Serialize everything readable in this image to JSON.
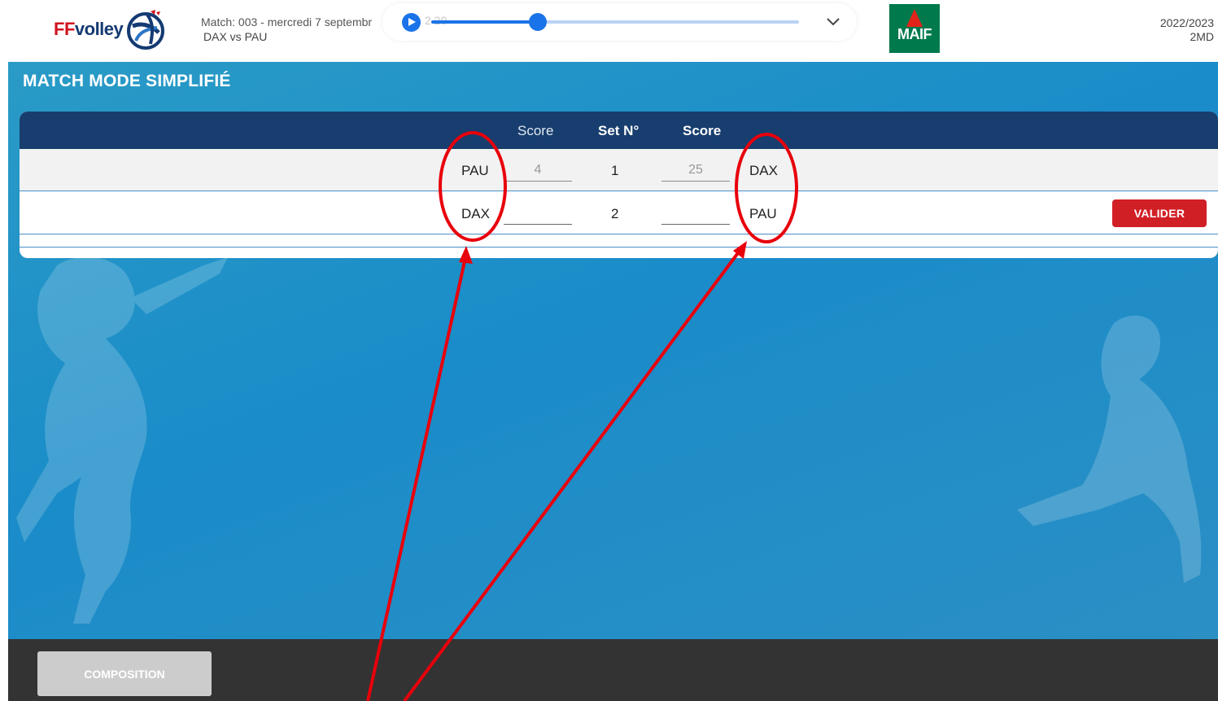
{
  "header": {
    "logo_ff": "FF",
    "logo_volley": "volley",
    "match_line1": "Match: 003 - mercredi 7 septembr",
    "match_line1_tail": "2 20",
    "match_line2": "DAX vs PAU",
    "player": {
      "progress_percent": 29
    },
    "sponsor": "MAIF",
    "season": "2022/2023",
    "division": "2MD"
  },
  "page": {
    "title": "MATCH MODE SIMPLIFIÉ"
  },
  "table": {
    "headers": {
      "score_left": "Score",
      "set": "Set N°",
      "score_right": "Score"
    },
    "rows": [
      {
        "team_left": "PAU",
        "score_left": "4",
        "set": "1",
        "score_right": "25",
        "team_right": "DAX"
      },
      {
        "team_left": "DAX",
        "score_left": "",
        "set": "2",
        "score_right": "",
        "team_right": "PAU"
      }
    ],
    "submit_label": "VALIDER"
  },
  "footer": {
    "composition_label": "COMPOSITION"
  },
  "colors": {
    "header_bg": "#ffffff",
    "main_bg": "#1a8cc9",
    "table_head_bg": "#173e6e",
    "accent_red": "#d11f26",
    "footer_bg": "#333333",
    "annotation_red": "#e8000b"
  }
}
